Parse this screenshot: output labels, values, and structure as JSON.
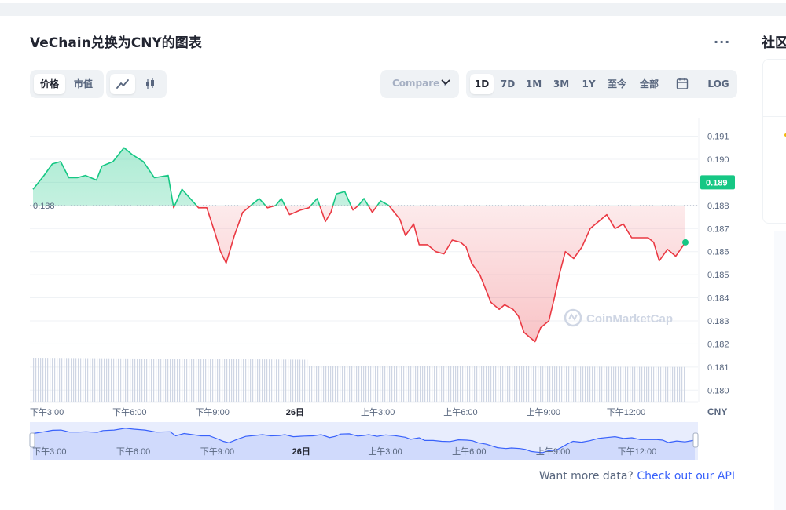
{
  "page": {
    "title": "VeChain兑换为CNY的图表",
    "side_title": "社区"
  },
  "toolbar": {
    "metric_tabs": [
      "价格",
      "市值"
    ],
    "active_metric": "价格",
    "chart_types": [
      "line-chart-icon",
      "candlestick-icon"
    ],
    "active_chart_type": "line-chart-icon",
    "compare_label": "Compare with",
    "ranges": [
      "1D",
      "7D",
      "1M",
      "3M",
      "1Y",
      "至今",
      "全部"
    ],
    "active_range": "1D",
    "calendar_icon": "calendar-icon",
    "log_label": "LOG"
  },
  "footer": {
    "text": "Want more data?",
    "link": "Check out our API"
  },
  "watermark": "CoinMarketCap",
  "colors": {
    "up": "#16c784",
    "down": "#ea3943",
    "accent": "#3861fb",
    "navigator": "#3861fb"
  },
  "chart_data": {
    "type": "area",
    "quote_currency": "CNY",
    "baseline": 0.188,
    "baseline_label": "0.188",
    "last_price": 0.189,
    "last_price_label": "0.189",
    "ylim": [
      0.1795,
      0.1918
    ],
    "y_ticks": [
      "0.191",
      "0.190",
      "0.189",
      "0.188",
      "0.187",
      "0.186",
      "0.185",
      "0.184",
      "0.183",
      "0.182",
      "0.181",
      "0.180"
    ],
    "y_tick_values": [
      0.191,
      0.19,
      0.189,
      0.188,
      0.187,
      0.186,
      0.185,
      0.184,
      0.183,
      0.182,
      0.181,
      0.18
    ],
    "x_ticks": [
      "下午3:00",
      "下午6:00",
      "下午9:00",
      "26日",
      "上午3:00",
      "上午6:00",
      "上午9:00",
      "下午12:00"
    ],
    "x_tick_hours": [
      0.5,
      3.5,
      6.5,
      9.5,
      12.5,
      15.5,
      18.5,
      21.5
    ],
    "x_range_hours": [
      0,
      23.65
    ],
    "series": [
      {
        "points": [
          [
            0.0,
            0.1887
          ],
          [
            0.4,
            0.1893
          ],
          [
            0.7,
            0.1898
          ],
          [
            1.0,
            0.1899
          ],
          [
            1.3,
            0.1892
          ],
          [
            1.6,
            0.1892
          ],
          [
            1.9,
            0.1893
          ],
          [
            2.3,
            0.1891
          ],
          [
            2.5,
            0.1897
          ],
          [
            2.9,
            0.1899
          ],
          [
            3.3,
            0.1905
          ],
          [
            3.6,
            0.1902
          ],
          [
            4.0,
            0.1899
          ],
          [
            4.4,
            0.1892
          ],
          [
            4.9,
            0.1893
          ],
          [
            5.1,
            0.1879
          ],
          [
            5.4,
            0.1887
          ],
          [
            6.0,
            0.1879
          ],
          [
            6.3,
            0.1879
          ],
          [
            6.6,
            0.1868
          ],
          [
            6.8,
            0.186
          ],
          [
            7.0,
            0.1855
          ],
          [
            7.3,
            0.1867
          ],
          [
            7.6,
            0.1877
          ],
          [
            7.9,
            0.188
          ],
          [
            8.2,
            0.1883
          ],
          [
            8.5,
            0.1879
          ],
          [
            8.8,
            0.188
          ],
          [
            9.0,
            0.1883
          ],
          [
            9.3,
            0.1876
          ],
          [
            9.7,
            0.1878
          ],
          [
            10.0,
            0.1879
          ],
          [
            10.3,
            0.1883
          ],
          [
            10.6,
            0.1873
          ],
          [
            10.8,
            0.1877
          ],
          [
            11.0,
            0.1885
          ],
          [
            11.3,
            0.1886
          ],
          [
            11.6,
            0.1878
          ],
          [
            11.8,
            0.188
          ],
          [
            12.0,
            0.1883
          ],
          [
            12.3,
            0.1877
          ],
          [
            12.6,
            0.1882
          ],
          [
            12.9,
            0.188
          ],
          [
            13.1,
            0.1877
          ],
          [
            13.3,
            0.1874
          ],
          [
            13.5,
            0.1867
          ],
          [
            13.8,
            0.1872
          ],
          [
            14.0,
            0.1863
          ],
          [
            14.3,
            0.1863
          ],
          [
            14.6,
            0.186
          ],
          [
            14.9,
            0.1859
          ],
          [
            15.2,
            0.1865
          ],
          [
            15.5,
            0.1864
          ],
          [
            15.7,
            0.1862
          ],
          [
            15.9,
            0.1855
          ],
          [
            16.2,
            0.185
          ],
          [
            16.4,
            0.1844
          ],
          [
            16.6,
            0.1838
          ],
          [
            16.9,
            0.1835
          ],
          [
            17.1,
            0.1837
          ],
          [
            17.4,
            0.1835
          ],
          [
            17.6,
            0.1832
          ],
          [
            17.8,
            0.1825
          ],
          [
            18.0,
            0.1823
          ],
          [
            18.2,
            0.1821
          ],
          [
            18.4,
            0.1827
          ],
          [
            18.7,
            0.183
          ],
          [
            18.9,
            0.184
          ],
          [
            19.1,
            0.1851
          ],
          [
            19.3,
            0.186
          ],
          [
            19.6,
            0.1857
          ],
          [
            19.9,
            0.1862
          ],
          [
            20.2,
            0.187
          ],
          [
            20.5,
            0.1873
          ],
          [
            20.8,
            0.1876
          ],
          [
            21.1,
            0.187
          ],
          [
            21.4,
            0.1872
          ],
          [
            21.7,
            0.1866
          ],
          [
            22.0,
            0.1866
          ],
          [
            22.3,
            0.1866
          ],
          [
            22.5,
            0.1864
          ],
          [
            22.7,
            0.1856
          ],
          [
            23.0,
            0.1861
          ],
          [
            23.3,
            0.1858
          ],
          [
            23.65,
            0.1864
          ]
        ]
      }
    ],
    "x_axis_note_hours_start": "下午2:30",
    "volume_bars_visible": true,
    "grid": true
  }
}
